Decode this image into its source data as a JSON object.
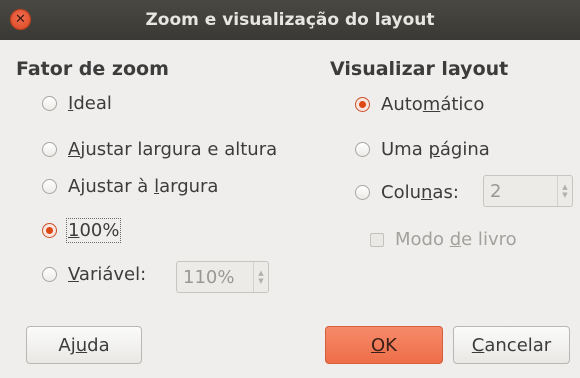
{
  "window": {
    "title": "Zoom e visualização do layout"
  },
  "zoom": {
    "title": "Fator de zoom",
    "options": [
      {
        "pre": "",
        "u": "I",
        "post": "deal",
        "checked": false
      },
      {
        "pre": "",
        "u": "A",
        "post": "justar largura e altura",
        "checked": false
      },
      {
        "pre": "Ajustar à ",
        "u": "l",
        "post": "argura",
        "checked": false
      },
      {
        "pre": "",
        "u": "1",
        "post": "00%",
        "checked": true
      },
      {
        "pre": "",
        "u": "V",
        "post": "ariável:",
        "checked": false
      }
    ],
    "variable_value": "110%"
  },
  "layout": {
    "title": "Visualizar layout",
    "options": [
      {
        "pre": "Auto",
        "u": "m",
        "post": "ático",
        "checked": true
      },
      {
        "pre": "Uma ",
        "u": "p",
        "post": "ágina",
        "checked": false
      },
      {
        "pre": "Colu",
        "u": "n",
        "post": "as:",
        "checked": false
      }
    ],
    "columns_value": "2",
    "book_mode": {
      "pre": "Modo ",
      "u": "d",
      "post": "e livro",
      "checked": false
    }
  },
  "buttons": {
    "help": {
      "pre": "Aj",
      "u": "u",
      "post": "da"
    },
    "ok": {
      "pre": "",
      "u": "O",
      "post": "K"
    },
    "cancel": {
      "pre": "",
      "u": "C",
      "post": "ancelar"
    }
  },
  "colors": {
    "accent": "#dd4814",
    "titlebar": "#3c3b37"
  }
}
